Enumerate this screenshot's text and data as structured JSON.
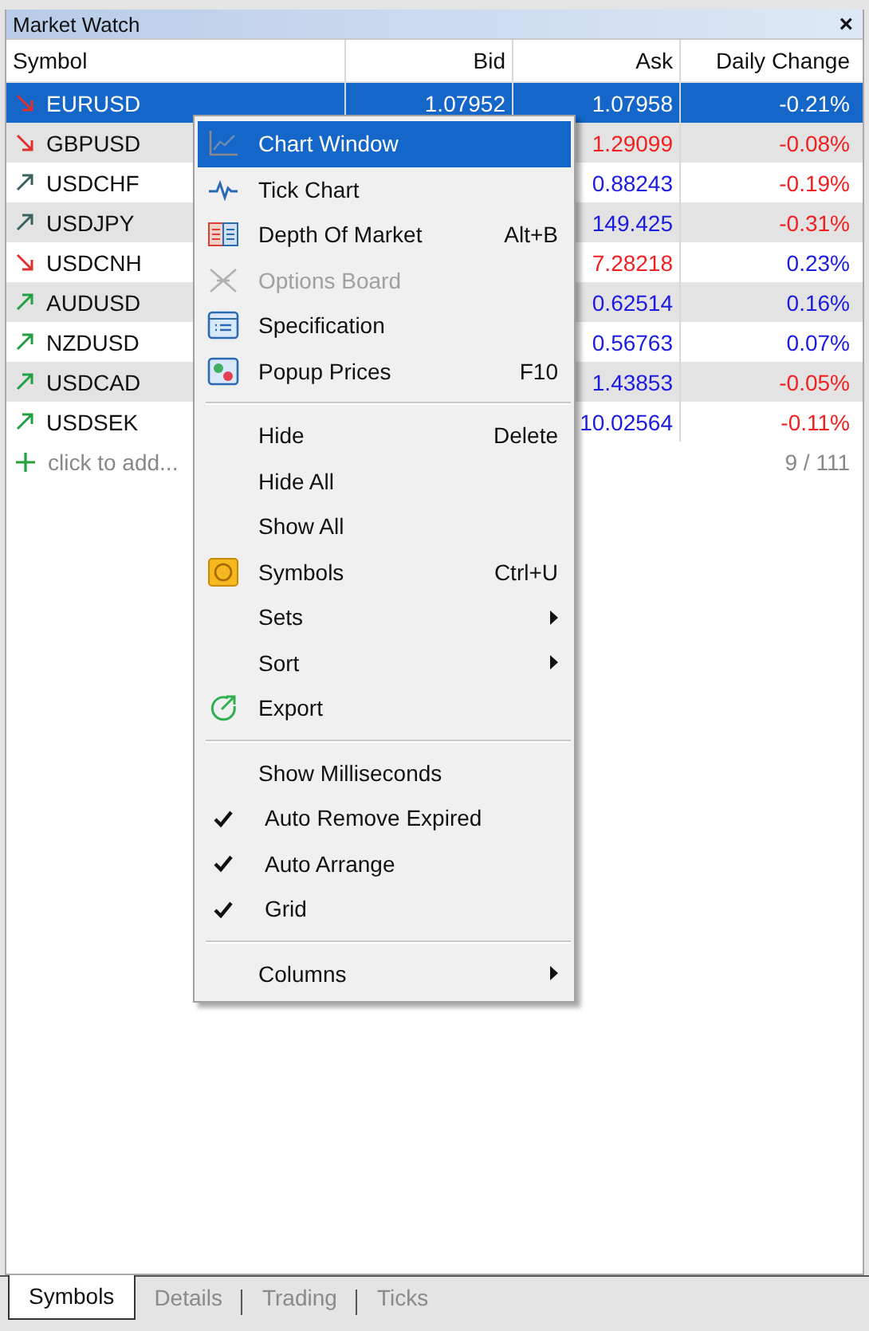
{
  "window": {
    "title": "Market Watch",
    "close": "×"
  },
  "table": {
    "columns": [
      "Symbol",
      "Bid",
      "Ask",
      "Daily Change"
    ],
    "rows": [
      {
        "symbol": "EURUSD",
        "bid": {
          "text": "1.07952",
          "color": "#ffffff"
        },
        "ask": {
          "text": "1.07958",
          "color": "#ffffff"
        },
        "change": {
          "text": "-0.21%",
          "color": "#ffffff"
        },
        "trend": {
          "kind": "down",
          "color": "#e03030"
        },
        "selected": true
      },
      {
        "symbol": "GBPUSD",
        "ask": {
          "text": "1.29099",
          "color": "#f02020"
        },
        "change": {
          "text": "-0.08%",
          "color": "#f02020"
        },
        "trend": {
          "kind": "down",
          "color": "#e03030"
        },
        "selected": false
      },
      {
        "symbol": "USDCHF",
        "ask": {
          "text": "0.88243",
          "color": "#1a1ae0"
        },
        "change": {
          "text": "-0.19%",
          "color": "#f02020"
        },
        "trend": {
          "kind": "up",
          "color": "#3a6060"
        },
        "selected": false
      },
      {
        "symbol": "USDJPY",
        "ask": {
          "text": "149.425",
          "color": "#1a1ae0"
        },
        "change": {
          "text": "-0.31%",
          "color": "#f02020"
        },
        "trend": {
          "kind": "up",
          "color": "#3a6060"
        },
        "selected": false
      },
      {
        "symbol": "USDCNH",
        "ask": {
          "text": "7.28218",
          "color": "#f02020"
        },
        "change": {
          "text": "0.23%",
          "color": "#1a1ae0"
        },
        "trend": {
          "kind": "down",
          "color": "#e03030"
        },
        "selected": false
      },
      {
        "symbol": "AUDUSD",
        "ask": {
          "text": "0.62514",
          "color": "#1a1ae0"
        },
        "change": {
          "text": "0.16%",
          "color": "#1a1ae0"
        },
        "trend": {
          "kind": "up",
          "color": "#20a040"
        },
        "selected": false
      },
      {
        "symbol": "NZDUSD",
        "ask": {
          "text": "0.56763",
          "color": "#1a1ae0"
        },
        "change": {
          "text": "0.07%",
          "color": "#1a1ae0"
        },
        "trend": {
          "kind": "up",
          "color": "#20a040"
        },
        "selected": false
      },
      {
        "symbol": "USDCAD",
        "ask": {
          "text": "1.43853",
          "color": "#1a1ae0"
        },
        "change": {
          "text": "-0.05%",
          "color": "#f02020"
        },
        "trend": {
          "kind": "up",
          "color": "#20a040"
        },
        "selected": false
      },
      {
        "symbol": "USDSEK",
        "ask": {
          "text": "10.02564",
          "color": "#1a1ae0"
        },
        "change": {
          "text": "-0.11%",
          "color": "#f02020"
        },
        "trend": {
          "kind": "up",
          "color": "#20a040"
        },
        "selected": false
      }
    ],
    "add_row": {
      "placeholder": "click to add...",
      "count": "9 / 111"
    }
  },
  "context_menu": [
    {
      "kind": "item",
      "label": "Chart Window",
      "selected": true,
      "disabled": false,
      "checked": false,
      "submenu": false
    },
    {
      "kind": "item",
      "label": "Tick Chart",
      "selected": false,
      "disabled": false,
      "checked": false,
      "submenu": false
    },
    {
      "kind": "item",
      "label": "Depth Of Market",
      "shortcut": "Alt+B",
      "selected": false,
      "disabled": false,
      "checked": false,
      "submenu": false
    },
    {
      "kind": "item",
      "label": "Options Board",
      "selected": false,
      "disabled": true,
      "checked": false,
      "submenu": false
    },
    {
      "kind": "item",
      "label": "Specification",
      "selected": false,
      "disabled": false,
      "checked": false,
      "submenu": false
    },
    {
      "kind": "item",
      "label": "Popup Prices",
      "shortcut": "F10",
      "selected": false,
      "disabled": false,
      "checked": false,
      "submenu": false
    },
    {
      "kind": "separator"
    },
    {
      "kind": "item",
      "label": "Hide",
      "shortcut": "Delete",
      "selected": false,
      "disabled": false,
      "checked": false,
      "submenu": false
    },
    {
      "kind": "item",
      "label": "Hide All",
      "selected": false,
      "disabled": false,
      "checked": false,
      "submenu": false
    },
    {
      "kind": "item",
      "label": "Show All",
      "selected": false,
      "disabled": false,
      "checked": false,
      "submenu": false
    },
    {
      "kind": "item",
      "label": "Symbols",
      "shortcut": "Ctrl+U",
      "selected": false,
      "disabled": false,
      "checked": false,
      "submenu": false
    },
    {
      "kind": "item",
      "label": "Sets",
      "selected": false,
      "disabled": false,
      "checked": false,
      "submenu": true
    },
    {
      "kind": "item",
      "label": "Sort",
      "selected": false,
      "disabled": false,
      "checked": false,
      "submenu": true
    },
    {
      "kind": "item",
      "label": "Export",
      "selected": false,
      "disabled": false,
      "checked": false,
      "submenu": false
    },
    {
      "kind": "separator"
    },
    {
      "kind": "item",
      "label": "Show Milliseconds",
      "selected": false,
      "disabled": false,
      "checked": false,
      "submenu": false
    },
    {
      "kind": "item",
      "label": "Auto Remove Expired",
      "selected": false,
      "disabled": false,
      "checked": true,
      "submenu": false
    },
    {
      "kind": "item",
      "label": "Auto Arrange",
      "selected": false,
      "disabled": false,
      "checked": true,
      "submenu": false
    },
    {
      "kind": "item",
      "label": "Grid",
      "selected": false,
      "disabled": false,
      "checked": true,
      "submenu": false
    },
    {
      "kind": "separator"
    },
    {
      "kind": "item",
      "label": "Columns",
      "selected": false,
      "disabled": false,
      "checked": false,
      "submenu": true
    }
  ],
  "tabs": [
    {
      "label": "Symbols",
      "selected": true
    },
    {
      "label": "Details",
      "selected": false
    },
    {
      "label": "Trading",
      "selected": false
    },
    {
      "label": "Ticks",
      "selected": false
    }
  ]
}
